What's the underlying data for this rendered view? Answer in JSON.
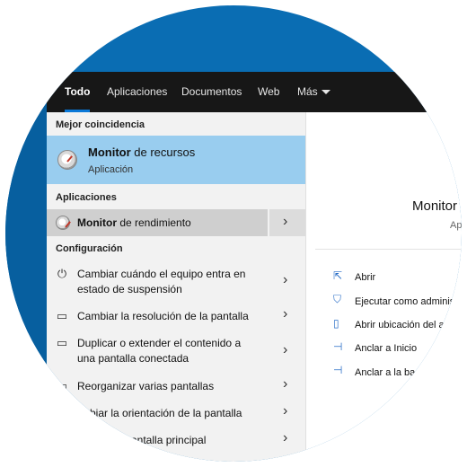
{
  "tabs": [
    {
      "label": "Todo"
    },
    {
      "label": "Aplicaciones"
    },
    {
      "label": "Documentos"
    },
    {
      "label": "Web"
    },
    {
      "label": "Más"
    }
  ],
  "sections": {
    "best": "Mejor coincidencia",
    "apps": "Aplicaciones",
    "settings": "Configuración"
  },
  "best_match": {
    "bold": "Monitor",
    "rest": " de recursos",
    "type": "Aplicación"
  },
  "app_result": {
    "bold": "Monitor",
    "rest": " de rendimiento"
  },
  "settings": [
    {
      "line1": "Cambiar cuándo el equipo entra en",
      "line2": "estado de suspensión",
      "icon": "power-icon"
    },
    {
      "line1": "Cambiar la resolución de la pantalla",
      "line2": "",
      "icon": "display-icon"
    },
    {
      "line1": "Duplicar o extender el contenido a",
      "line2": "una pantalla conectada",
      "icon": "display-icon"
    },
    {
      "line1": "Reorganizar varias pantallas",
      "line2": "",
      "icon": "display-icon"
    },
    {
      "line1": "mbiar la orientación de la pantalla",
      "line2": "",
      "icon": "display-icon"
    },
    {
      "line1": "antalla principal",
      "line2": "",
      "icon": "display-icon"
    }
  ],
  "preview": {
    "title": "Monitor",
    "subtitle": "Ap"
  },
  "actions": [
    {
      "label": "Abrir",
      "icon": "open-icon"
    },
    {
      "label": "Ejecutar como adminis",
      "icon": "shield-icon"
    },
    {
      "label": "Abrir ubicación del a",
      "icon": "file-location-icon"
    },
    {
      "label": "Anclar a Inicio",
      "icon": "pin-icon"
    },
    {
      "label": "Anclar a la ba",
      "icon": "pin-icon"
    }
  ],
  "colors": {
    "desktop": "#0a6db3",
    "topbar": "#171717",
    "accent": "#0a78d7",
    "selection": "#99cdef"
  }
}
